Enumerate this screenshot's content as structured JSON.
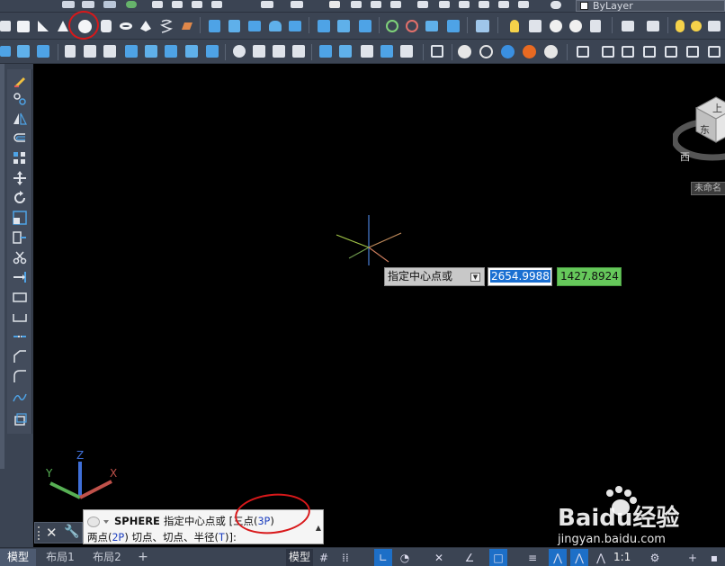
{
  "app": {
    "layer_dropdown": {
      "value": "ByLayer"
    }
  },
  "toolbars": {
    "row1_icons": [
      "print-icon",
      "preview-icon",
      "plot-icon",
      "publish-icon",
      "cut-icon",
      "copy-icon",
      "paste-icon",
      "match-icon",
      "undo-icon",
      "redo-icon",
      "pan-icon",
      "zoom-realtime-icon",
      "zoom-window-icon",
      "zoom-previous-icon",
      "properties-icon",
      "design-center-icon",
      "tool-palette-icon",
      "sheet-set-icon",
      "markup-icon",
      "calculator-icon",
      "help-icon"
    ],
    "row2_icons": [
      "box-icon",
      "wedge-icon",
      "cone-icon",
      "sphere-icon",
      "cylinder-icon",
      "torus-icon",
      "pyramid-icon",
      "helix-icon",
      "planar-surface-icon",
      "extrude-icon",
      "presspull-icon",
      "sweep-icon",
      "revolve-icon",
      "loft-icon",
      "union-icon",
      "subtract-icon",
      "intersect-icon",
      "solid-history-icon",
      "3d-move-icon",
      "3d-rotate-icon",
      "3d-align-icon",
      "3d-array-icon",
      "section-icon",
      "light-icon",
      "point-light-icon",
      "spot-light-icon",
      "material-icon",
      "render-icon"
    ],
    "row3_icons": [
      "ucs-icon",
      "ucs-world-icon",
      "ucs-previous-icon",
      "ucs-face-icon",
      "ucs-object-icon",
      "ucs-view-icon",
      "ucs-origin-icon",
      "ucs-zaxis-icon",
      "ucs-3point-icon",
      "ucs-x-icon",
      "ucs-y-icon",
      "ucs-z-icon",
      "ucs-apply-icon",
      "visual-style-2d-icon",
      "visual-style-wire-icon",
      "visual-style-hidden-icon",
      "visual-style-realistic-icon",
      "visual-style-conceptual-icon",
      "manage-styles-icon",
      "view-top-icon",
      "view-bottom-icon",
      "view-left-icon",
      "view-right-icon",
      "view-front-icon",
      "view-back-icon"
    ]
  },
  "left_toolbar": {
    "icons": [
      "erase-icon",
      "copy-object-icon",
      "mirror-icon",
      "offset-icon",
      "array-icon",
      "move-icon",
      "rotate-icon",
      "scale-icon",
      "stretch-icon",
      "trim-icon",
      "extend-icon",
      "break-point-icon",
      "break-icon",
      "join-icon",
      "chamfer-icon",
      "fillet-icon",
      "blend-icon",
      "explode-icon"
    ]
  },
  "dynamic_input": {
    "prompt": "指定中心点或",
    "x_value": "2654.9988",
    "y_value": "1427.8924"
  },
  "viewcube": {
    "top_label": "上",
    "face_label": "东",
    "compass_label": "西",
    "ucs_menu": "未命名"
  },
  "ucs_icon": {
    "x_label": "X",
    "y_label": "Y",
    "z_label": "Z"
  },
  "command_line": {
    "command": "SPHERE",
    "prompt_part": "指定中心点或",
    "open_bracket": "[",
    "opt1_text": "三点(",
    "opt1_key": "3P",
    "opt1_close": ")",
    "opt2_text": "两点(",
    "opt2_key": "2P",
    "opt2_close": ")",
    "opt3_text": "切点、切点、半径(",
    "opt3_key": "T",
    "opt3_close": ")",
    "close_bracket": "]:"
  },
  "layout_tabs": {
    "model": "模型",
    "layout1": "布局1",
    "layout2": "布局2",
    "add": "+"
  },
  "status_bar": {
    "model_label": "模型",
    "scale": "1:1"
  },
  "watermark": {
    "brand": "Baidu经验",
    "url": "jingyan.baidu.com"
  },
  "colors": {
    "toolbar_bg": "#3b4453",
    "canvas_bg": "#000000",
    "annotation_red": "#d8181a",
    "dyn_y_green": "#66c85b",
    "selection_blue": "#1a6fd1"
  }
}
